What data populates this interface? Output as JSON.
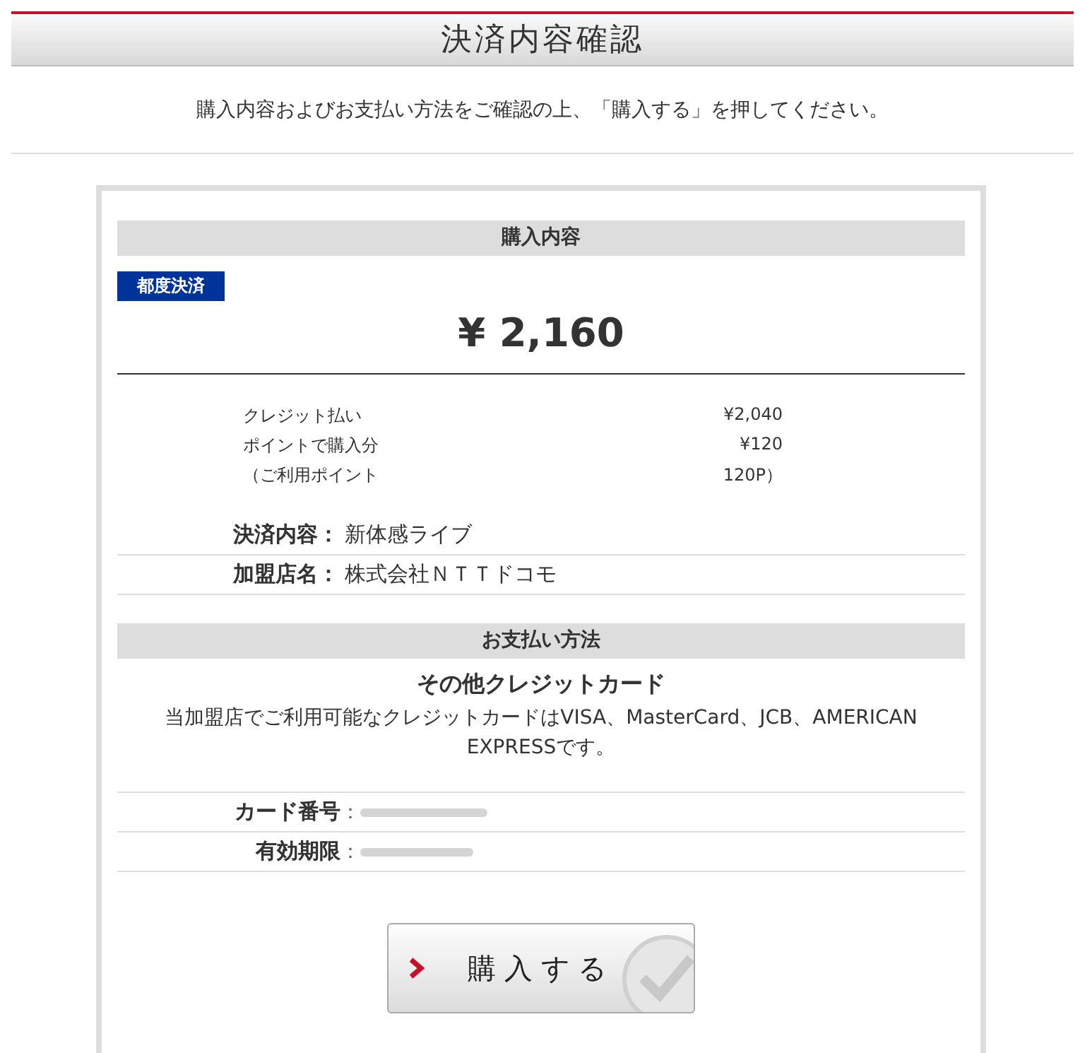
{
  "page_title": "決済内容確認",
  "instruction": "購入内容およびお支払い方法をご確認の上、「購入する」を押してください。",
  "purchase": {
    "heading": "購入内容",
    "badge": "都度決済",
    "amount": "¥ 2,160",
    "breakdown": [
      {
        "label": "クレジット払い",
        "value": "¥2,040"
      },
      {
        "label": "ポイントで購入分",
        "value": "¥120"
      },
      {
        "label": "（ご利用ポイント",
        "value": "120P）"
      }
    ],
    "details": [
      {
        "label": "決済内容：",
        "value": "新体感ライブ"
      },
      {
        "label": "加盟店名：",
        "value": "株式会社ＮＴＴドコモ"
      }
    ]
  },
  "payment": {
    "heading": "お支払い方法",
    "method": "その他クレジットカード",
    "note": "当加盟店でご利用可能なクレジットカードはVISA、MasterCard、JCB、AMERICAN EXPRESSです。",
    "fields": [
      {
        "label": "カード番号",
        "separator": "："
      },
      {
        "label": "有効期限",
        "separator": "："
      }
    ]
  },
  "buy_button": {
    "label": "購入する"
  }
}
